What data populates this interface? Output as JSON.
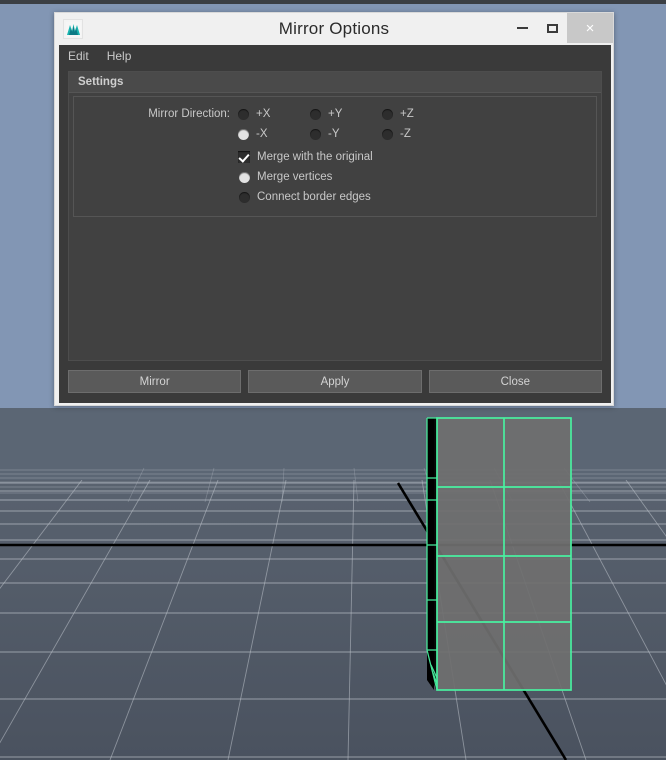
{
  "window": {
    "title": "Mirror Options",
    "icon": "maya-app-icon",
    "controls": {
      "minimize": "minimize-icon",
      "maximize": "maximize-icon",
      "close": "×"
    }
  },
  "menubar": {
    "items": [
      {
        "label": "Edit",
        "name": "menu-item-edit"
      },
      {
        "label": "Help",
        "name": "menu-item-help"
      }
    ]
  },
  "settings": {
    "frame_title": "Settings",
    "mirror_direction": {
      "label": "Mirror Direction:",
      "options": [
        {
          "label": "+X",
          "selected": false
        },
        {
          "label": "+Y",
          "selected": false
        },
        {
          "label": "+Z",
          "selected": false
        },
        {
          "label": "-X",
          "selected": true
        },
        {
          "label": "-Y",
          "selected": false
        },
        {
          "label": "-Z",
          "selected": false
        }
      ]
    },
    "merge_with_original": {
      "label": "Merge with the original",
      "checked": true
    },
    "merge_vertices": {
      "label": "Merge vertices",
      "selected": true
    },
    "connect_border_edges": {
      "label": "Connect border edges",
      "selected": false
    }
  },
  "buttons": [
    {
      "label": "Mirror",
      "name": "mirror-button"
    },
    {
      "label": "Apply",
      "name": "apply-button"
    },
    {
      "label": "Close",
      "name": "close-button"
    }
  ],
  "viewport": {
    "name": "maya-3d-viewport",
    "sky_color": "#5b6674",
    "floor_color": "#4e5765",
    "grid_line_color": "#b9bec6",
    "axis_line_color": "#000000",
    "selection_color": "#49f0a0",
    "mesh_face_color": "#6f6f6f",
    "mesh_side_color": "#050505",
    "mesh_name": "mirrored-box-mesh",
    "mesh_grid": "2 columns x 4 rows"
  }
}
